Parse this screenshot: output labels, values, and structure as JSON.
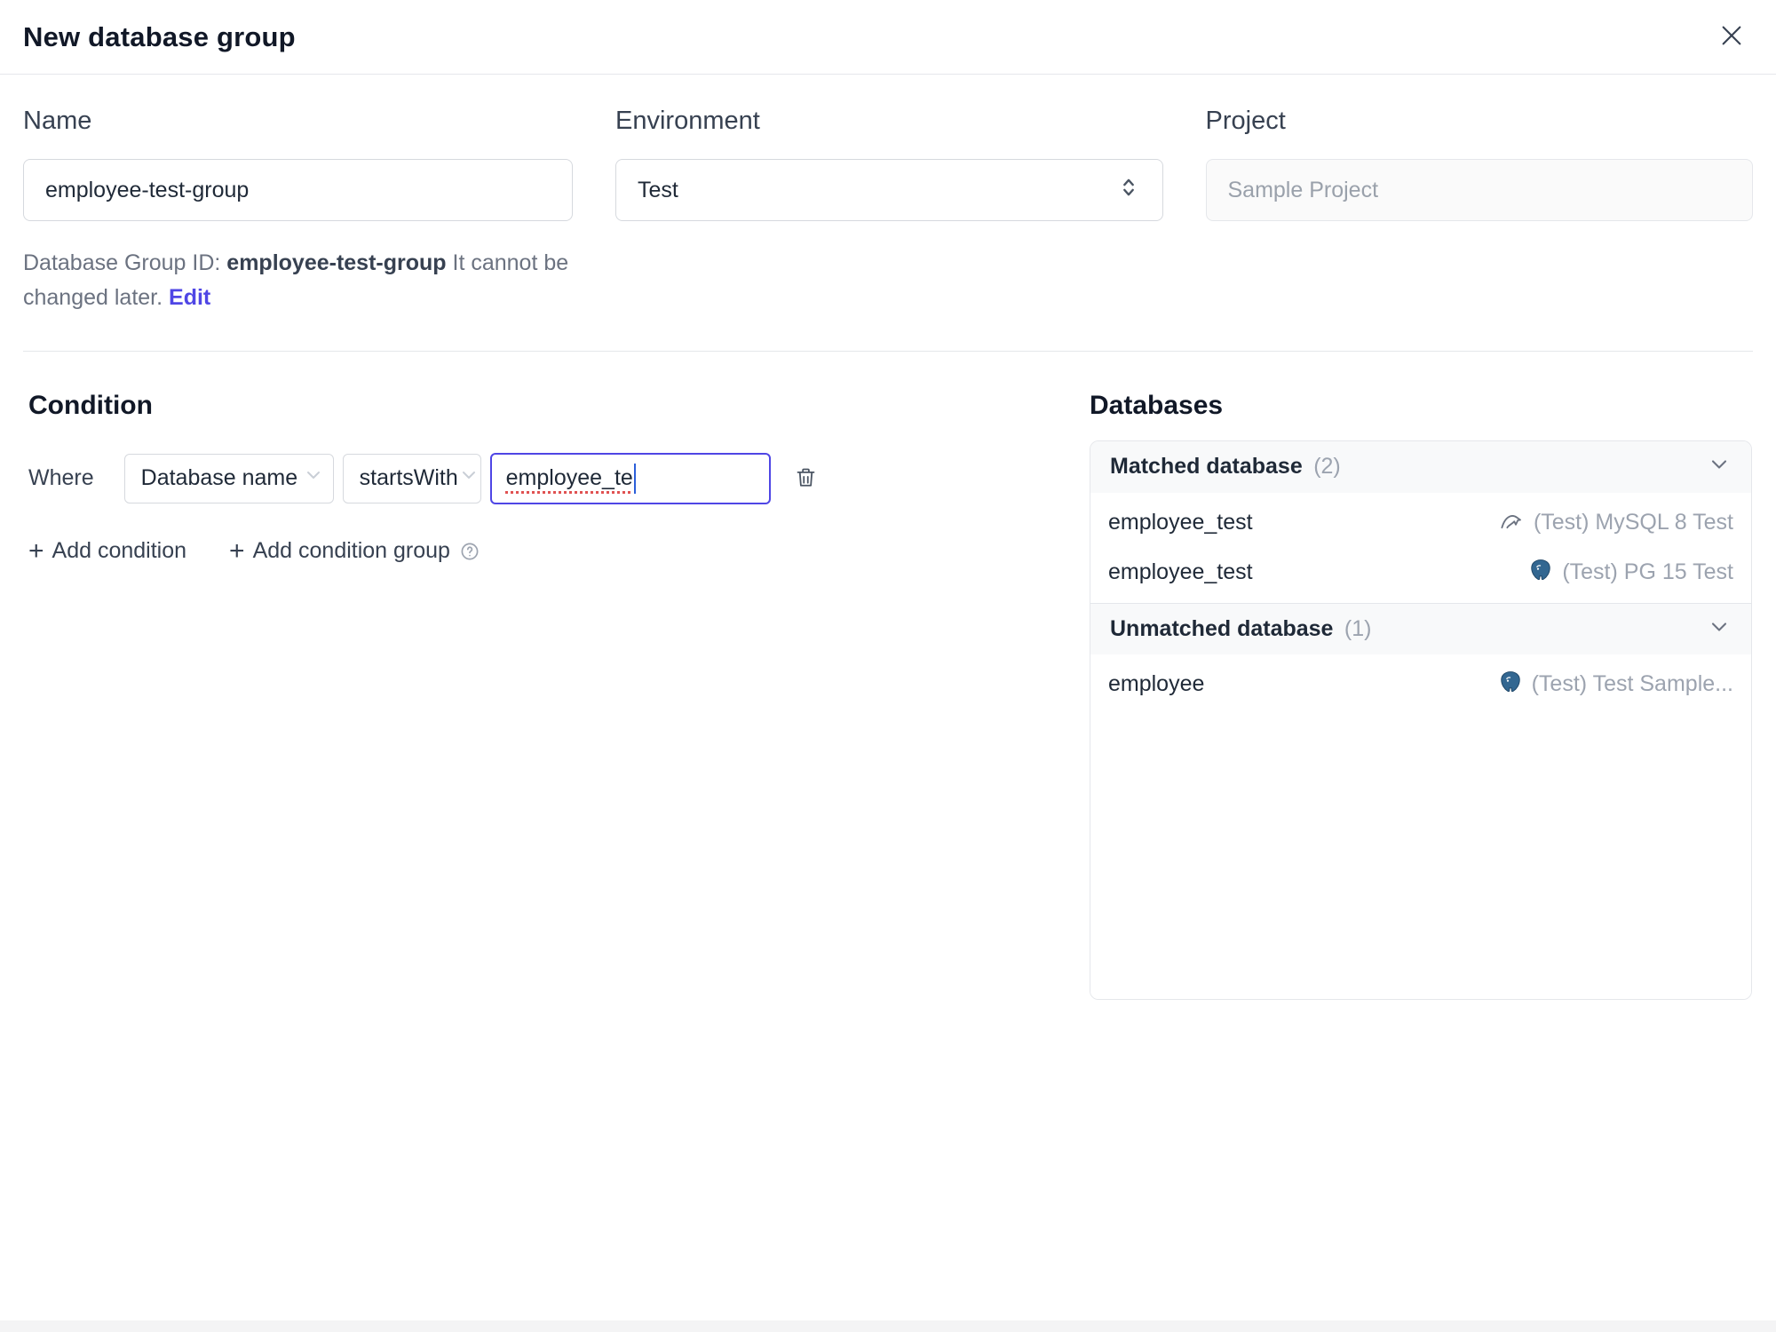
{
  "dialog": {
    "title": "New database group"
  },
  "form": {
    "name": {
      "label": "Name",
      "value": "employee-test-group"
    },
    "environment": {
      "label": "Environment",
      "value": "Test"
    },
    "project": {
      "label": "Project",
      "value": "Sample Project"
    },
    "group_id": {
      "prefix": "Database Group ID: ",
      "id": "employee-test-group",
      "suffix": " It cannot be changed later. ",
      "edit_label": "Edit"
    }
  },
  "condition": {
    "heading": "Condition",
    "where_label": "Where",
    "field_value": "Database name",
    "operator_value": "startsWith",
    "input_value": "employee_te",
    "add_condition_label": "Add condition",
    "add_condition_group_label": "Add condition group"
  },
  "databases": {
    "heading": "Databases",
    "matched": {
      "title": "Matched database",
      "count": "(2)",
      "rows": [
        {
          "name": "employee_test",
          "engine": "mysql",
          "instance": "(Test) MySQL 8 Test"
        },
        {
          "name": "employee_test",
          "engine": "postgres",
          "instance": "(Test) PG 15 Test"
        }
      ]
    },
    "unmatched": {
      "title": "Unmatched database",
      "count": "(1)",
      "rows": [
        {
          "name": "employee",
          "engine": "postgres",
          "instance": "(Test) Test Sample..."
        }
      ]
    }
  },
  "colors": {
    "accent": "#4f46e5",
    "border": "#e5e7eb",
    "muted_text": "#9ca3af",
    "spellcheck_underline": "#e05252",
    "postgres_brand": "#336791",
    "mysql_icon": "#6b7280",
    "panel_header_bg": "#f8f9fa"
  }
}
